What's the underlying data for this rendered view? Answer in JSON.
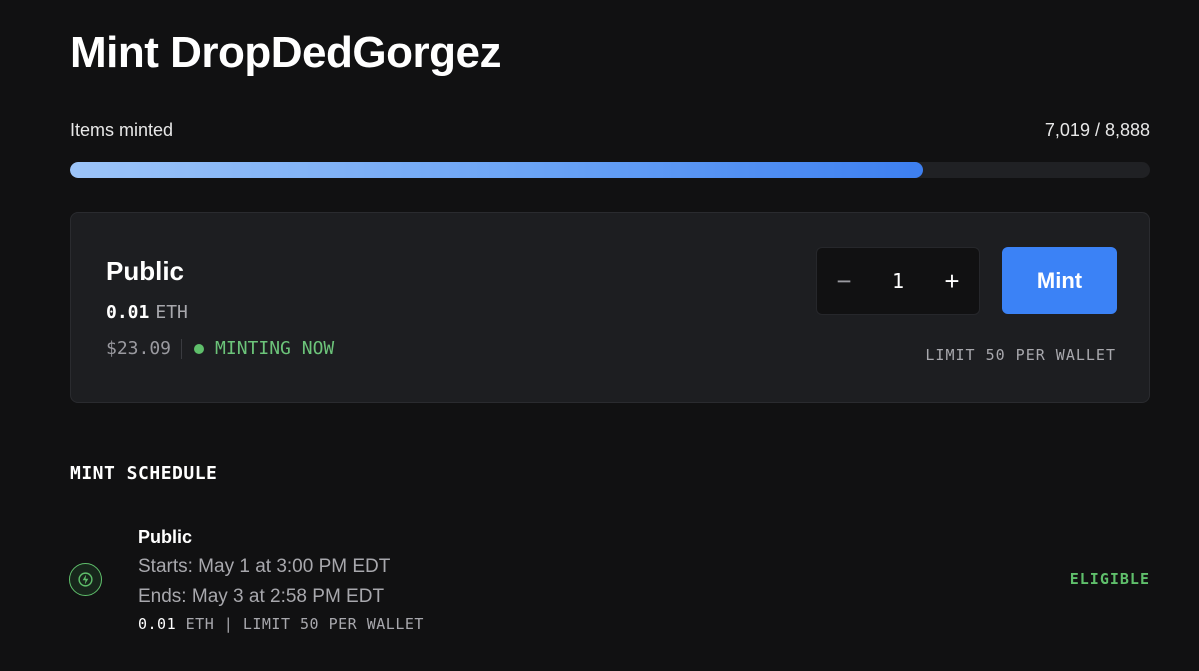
{
  "page": {
    "title": "Mint DropDedGorgez"
  },
  "progress": {
    "label": "Items minted",
    "count_text": "7,019 / 8,888",
    "minted": 7019,
    "total": 8888,
    "colors": {
      "start": "#9cc4f8",
      "end": "#3d7ff0",
      "track": "#202124"
    }
  },
  "stage_card": {
    "name": "Public",
    "price": "0.01",
    "currency": "ETH",
    "usd_price": "$23.09",
    "status": "MINTING NOW",
    "status_color": "#5fbf6b",
    "quantity": "1",
    "decrement_symbol": "−",
    "increment_symbol": "+",
    "mint_label": "Mint",
    "limit": "LIMIT 50 PER WALLET",
    "accent": "#3b82f6"
  },
  "schedule": {
    "heading": "MINT SCHEDULE",
    "items": [
      {
        "icon": "lightning-icon",
        "name": "Public",
        "starts": "Starts: May 1 at 3:00 PM EDT",
        "ends": "Ends: May 3 at 2:58 PM EDT",
        "price": "0.01",
        "meta_rest": "ETH | LIMIT 50 PER WALLET",
        "eligibility": "ELIGIBLE"
      }
    ]
  }
}
